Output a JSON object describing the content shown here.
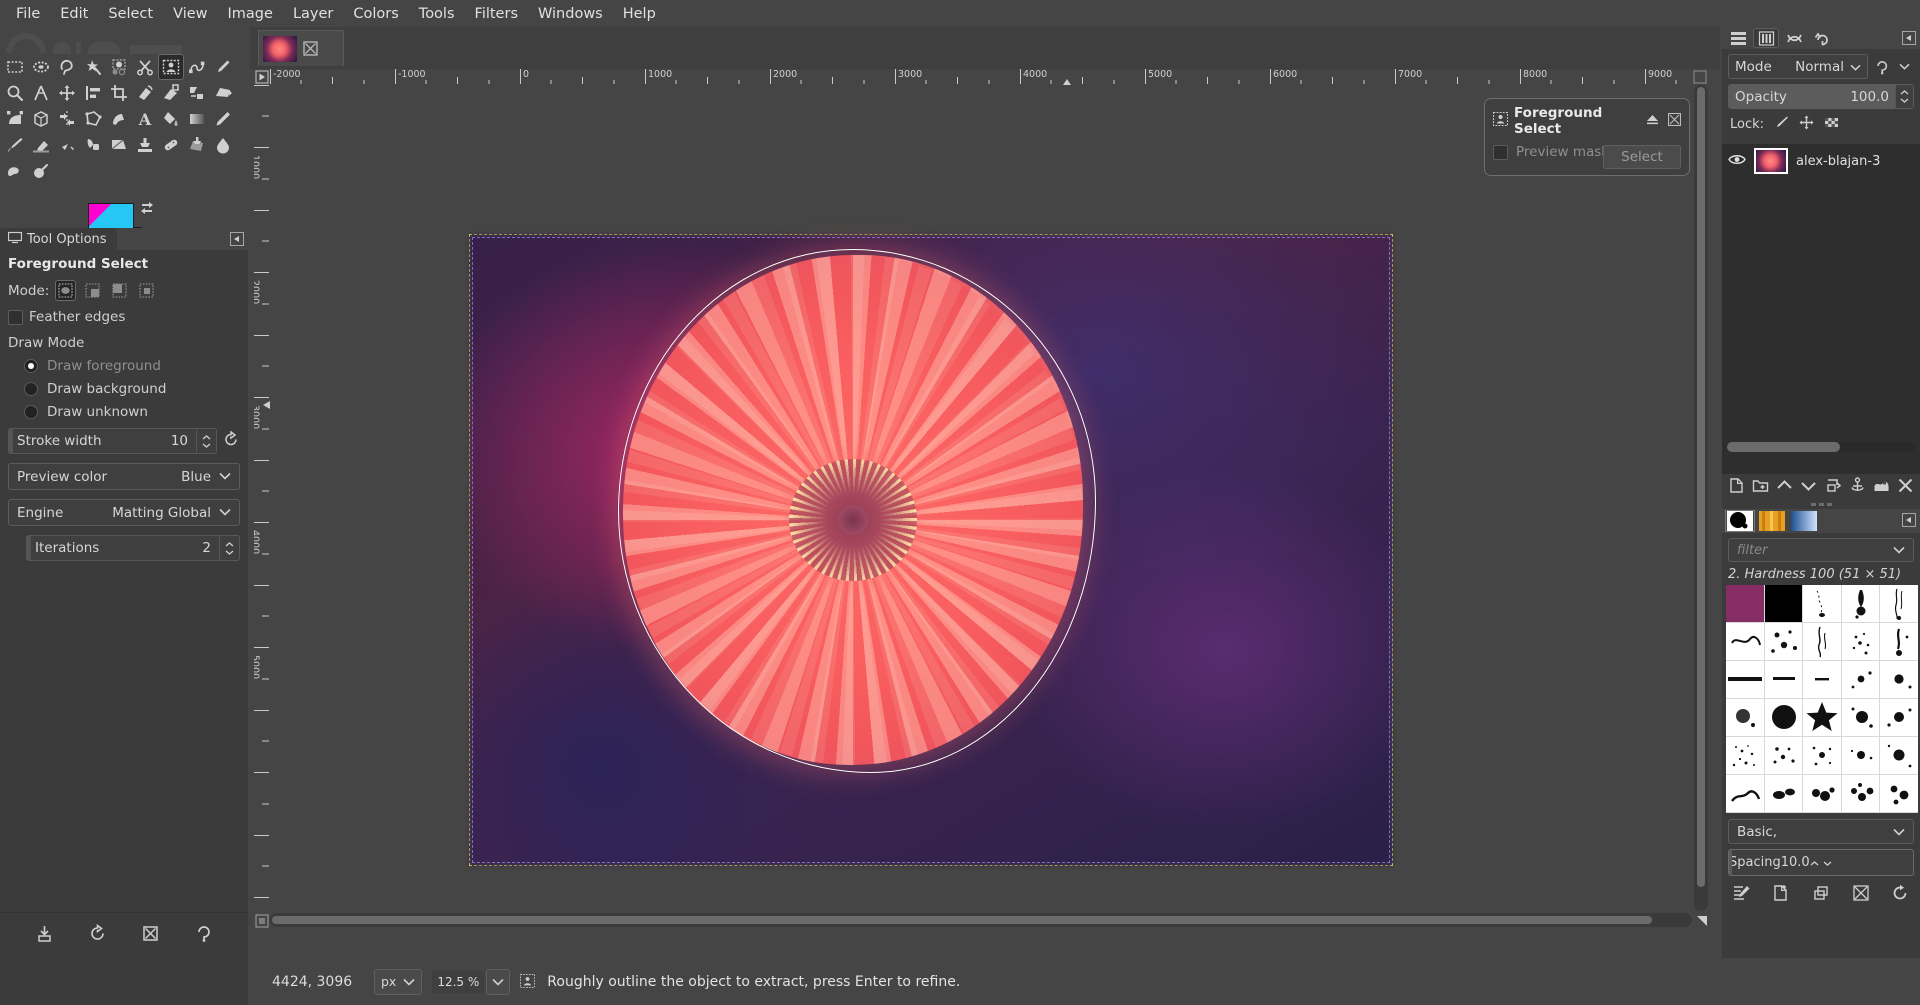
{
  "menubar": {
    "items": [
      {
        "label": "File"
      },
      {
        "label": "Edit"
      },
      {
        "label": "Select"
      },
      {
        "label": "View"
      },
      {
        "label": "Image"
      },
      {
        "label": "Layer"
      },
      {
        "label": "Colors"
      },
      {
        "label": "Tools"
      },
      {
        "label": "Filters"
      },
      {
        "label": "Windows"
      },
      {
        "label": "Help"
      }
    ]
  },
  "toolbox": {
    "tools": [
      {
        "name": "rect-select-icon"
      },
      {
        "name": "ellipse-select-icon"
      },
      {
        "name": "free-select-icon"
      },
      {
        "name": "fuzzy-select-icon"
      },
      {
        "name": "select-by-color-icon"
      },
      {
        "name": "scissors-select-icon"
      },
      {
        "name": "foreground-select-icon",
        "selected": true
      },
      {
        "name": "paths-icon"
      },
      {
        "name": "color-picker-icon"
      },
      {
        "name": "zoom-icon"
      },
      {
        "name": "measure-icon"
      },
      {
        "name": "move-icon"
      },
      {
        "name": "align-icon"
      },
      {
        "name": "crop-icon"
      },
      {
        "name": "rotate-icon"
      },
      {
        "name": "scale-icon"
      },
      {
        "name": "shear-icon"
      },
      {
        "name": "perspective-icon"
      },
      {
        "name": "unified-transform-icon"
      },
      {
        "name": "handle-transform-icon"
      },
      {
        "name": "flip-icon"
      },
      {
        "name": "cage-transform-icon"
      },
      {
        "name": "warp-transform-icon"
      },
      {
        "name": "bucket-fill-icon"
      },
      {
        "name": "text-icon"
      },
      {
        "name": "gradient-icon"
      },
      {
        "name": "pencil-icon"
      },
      {
        "name": "paintbrush-icon"
      },
      {
        "name": "eraser-icon"
      },
      {
        "name": "airbrush-icon"
      },
      {
        "name": "ink-icon"
      },
      {
        "name": "mypaint-brush-icon"
      },
      {
        "name": "clone-icon"
      },
      {
        "name": "heal-icon"
      },
      {
        "name": "perspective-clone-icon"
      },
      {
        "name": "blur-sharpen-icon"
      },
      {
        "name": "smudge-icon"
      },
      {
        "name": "dodge-burn-icon"
      }
    ],
    "foreground_color": "#25c8f5",
    "background_color": "#ffffff"
  },
  "tool_options": {
    "tab_label": "Tool Options",
    "title": "Foreground Select",
    "mode_label": "Mode:",
    "mode_buttons": [
      "replace",
      "add",
      "subtract",
      "intersect"
    ],
    "feather_edges_label": "Feather edges",
    "feather_edges_checked": false,
    "draw_mode_label": "Draw Mode",
    "draw_modes": [
      {
        "label": "Draw foreground",
        "selected": true
      },
      {
        "label": "Draw background",
        "selected": false
      },
      {
        "label": "Draw unknown",
        "selected": false
      }
    ],
    "stroke_width_label": "Stroke width",
    "stroke_width_value": "10",
    "preview_color_label": "Preview color",
    "preview_color_value": "Blue",
    "engine_label": "Engine",
    "engine_value": "Matting Global",
    "iterations_label": "Iterations",
    "iterations_value": "2",
    "footer_buttons": [
      "save-tool-preset-icon",
      "restore-tool-preset-icon",
      "delete-tool-preset-icon",
      "reset-tool-options-icon"
    ]
  },
  "canvas": {
    "tab_title": "alex-blajan-3",
    "ruler_h_labels": [
      "-2000",
      "-1000",
      "0",
      "1000",
      "2000",
      "3000",
      "4000",
      "5000",
      "6000",
      "7000",
      "8000",
      "9000"
    ],
    "ruler_v_labels": [
      "1000",
      "2000",
      "3000",
      "4000",
      "5000"
    ],
    "selection_hint": "white-outline"
  },
  "fg_dialog": {
    "title": "Foreground Select",
    "icon": "foreground-select-icon",
    "preview_mask_label": "Preview mask",
    "preview_mask_checked": false,
    "select_button": "Select"
  },
  "layers_dock": {
    "tabs": [
      "layers-tab",
      "channels-tab",
      "paths-tab",
      "undo-history-tab"
    ],
    "mode_label": "Mode",
    "mode_value": "Normal",
    "opacity_label": "Opacity",
    "opacity_value": "100.0",
    "lock_label": "Lock:",
    "lock_icons": [
      "lock-pixels-icon",
      "lock-position-icon",
      "lock-alpha-icon"
    ],
    "layers": [
      {
        "name": "alex-blajan-3",
        "visible": true,
        "selected": true
      }
    ],
    "buttons": [
      "new-layer-icon",
      "new-layer-group-icon",
      "raise-layer-icon",
      "lower-layer-icon",
      "duplicate-layer-icon",
      "anchor-layer-icon",
      "merge-down-icon",
      "delete-layer-icon"
    ]
  },
  "brushes_dock": {
    "tabs": [
      "brushes-tab",
      "patterns-tab",
      "gradients-tab"
    ],
    "filter_placeholder": "filter",
    "selected_brush": "2. Hardness 100 (51 × 51)",
    "preset_label": "Basic,",
    "spacing_label": "Spacing",
    "spacing_value": "10.0",
    "buttons": [
      "edit-brush-icon",
      "new-brush-icon",
      "duplicate-brush-icon",
      "delete-brush-icon",
      "refresh-brushes-icon"
    ]
  },
  "statusbar": {
    "position": "4424, 3096",
    "unit": "px",
    "zoom": "12.5 %",
    "hint": "Roughly outline the object to extract, press Enter to refine."
  }
}
